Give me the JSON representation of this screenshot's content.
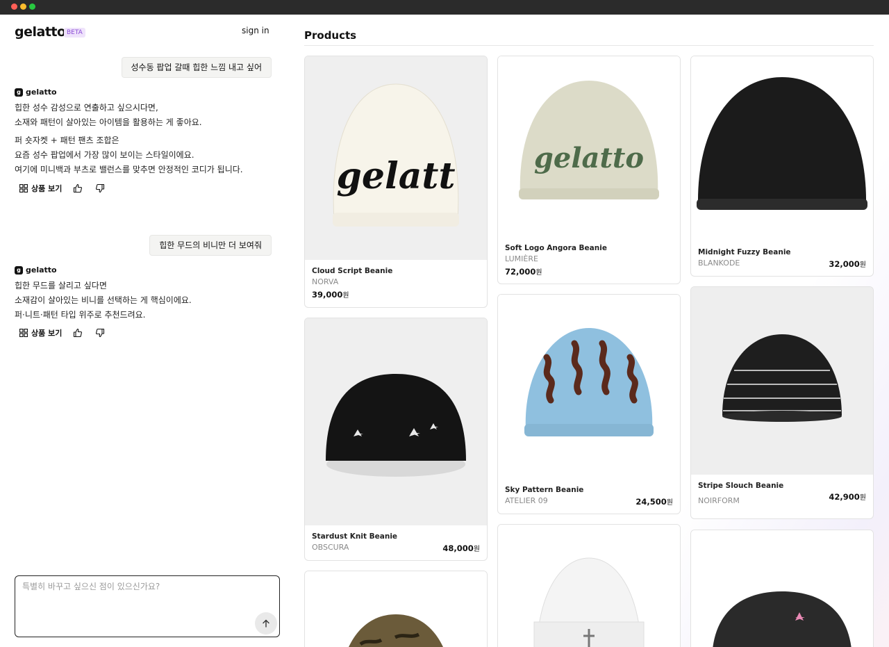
{
  "app": {
    "logo": "gelatto",
    "beta": "BETA",
    "sign_in": "sign in"
  },
  "chat": {
    "user_messages": [
      "성수동 팝업 갈때 힙한 느낌 내고 싶어",
      "힙한 무드의 비니만 더 보여줘"
    ],
    "bot_name": "gelatto",
    "bot_responses": [
      {
        "lines": [
          "힙한 성수 감성으로 연출하고 싶으시다면,",
          "소재와 패턴이 살아있는 아이템을 활용하는 게 좋아요.",
          "퍼 숏자켓 + 패턴 팬츠 조합은",
          "요즘 성수 팝업에서 가장 많이 보이는 스타일이에요.",
          "여기에 미니백과 부츠로 밸런스를 맞추면 안정적인 코디가 됩니다."
        ]
      },
      {
        "lines": [
          "힙한 무드를 살리고 싶다면",
          " 소재감이 살아있는 비니를 선택하는 게 핵심이에요.",
          " 퍼·니트·패턴 타입 위주로 추천드려요."
        ]
      }
    ],
    "view_products_label": "상품 보기",
    "input_placeholder": "특별히 바꾸고 싶으신 점이 있으신가요?"
  },
  "products": {
    "title": "Products",
    "currency": "원",
    "items": [
      {
        "name": "Cloud Script Beanie",
        "brand": "NORVA",
        "price": "39,000",
        "bg": "#efefef",
        "hat": "#f6f3ea",
        "logo": "gelatt"
      },
      {
        "name": "Soft Logo Angora Beanie",
        "brand": "LUMIÈRE",
        "price": "72,000",
        "bg": "#ffffff",
        "hat": "#d9d8c6",
        "logo": "gelatto"
      },
      {
        "name": "Midnight Fuzzy Beanie",
        "brand": "BLANKODE",
        "price": "32,000",
        "bg": "#ffffff",
        "hat": "#1b1b1b",
        "logo": ""
      },
      {
        "name": "Stardust Knit Beanie",
        "brand": "OBSCURA",
        "price": "48,000",
        "bg": "#efefef",
        "hat": "#141414",
        "logo": ""
      },
      {
        "name": "Sky Pattern Beanie",
        "brand": "ATELIER 09",
        "price": "24,500",
        "bg": "#ffffff",
        "hat": "#8fc0df",
        "logo": ""
      },
      {
        "name": "Stripe Slouch Beanie",
        "brand": "NOIRFORM",
        "price": "42,900",
        "bg": "#eeeeee",
        "hat": "#1e1e1e",
        "logo": ""
      }
    ],
    "extra_cards": [
      {
        "bg": "#ffffff",
        "hat": "#6b5b3a"
      },
      {
        "bg": "#ffffff",
        "hat": "#f3f3f3"
      },
      {
        "bg": "#ffffff",
        "hat": "#2a2a2a"
      }
    ]
  }
}
